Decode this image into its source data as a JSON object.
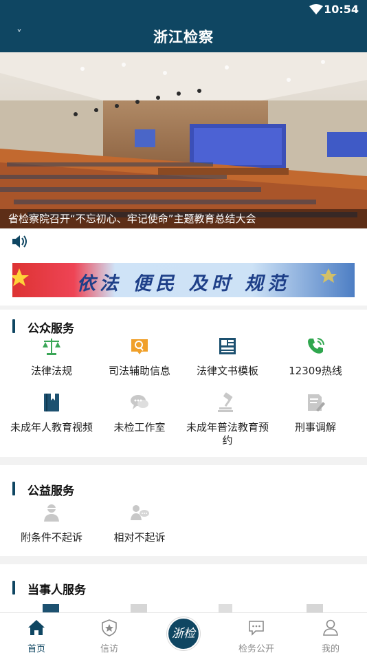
{
  "status": {
    "time": "10:54"
  },
  "app": {
    "title": "浙江检察",
    "back_glyph": "˅"
  },
  "banner": {
    "caption": "省检察院召开“不忘初心、牢记使命”主题教育总结大会"
  },
  "slogan": {
    "text": "依法 便民 及时 规范"
  },
  "public_services": {
    "title": "公众服务",
    "items": [
      {
        "label": "法律法规",
        "icon": "scales-icon",
        "color": "#3aa657"
      },
      {
        "label": "司法辅助信息",
        "icon": "search-doc-icon",
        "color": "#f0a02a"
      },
      {
        "label": "法律文书模板",
        "icon": "template-icon",
        "color": "#1d5170"
      },
      {
        "label": "12309热线",
        "icon": "phone-icon",
        "color": "#2fa64e"
      },
      {
        "label": "未成年人教育视频",
        "icon": "book-icon",
        "color": "#1d5170"
      },
      {
        "label": "未检工作室",
        "icon": "chat-icon",
        "color": "#c8c8c8"
      },
      {
        "label": "未成年普法教育预约",
        "icon": "gavel-icon",
        "color": "#c8c8c8"
      },
      {
        "label": "刑事调解",
        "icon": "edit-doc-icon",
        "color": "#c8c8c8"
      }
    ]
  },
  "welfare_services": {
    "title": "公益服务",
    "items": [
      {
        "label": "附条件不起诉",
        "icon": "person-icon",
        "color": "#c8c8c8"
      },
      {
        "label": "相对不起诉",
        "icon": "person-chat-icon",
        "color": "#c8c8c8"
      }
    ]
  },
  "party_services": {
    "title": "当事人服务"
  },
  "tabs": [
    {
      "label": "首页",
      "icon": "home-icon",
      "active": true
    },
    {
      "label": "信访",
      "icon": "badge-star-icon",
      "active": false
    },
    {
      "label": "",
      "icon": "zhejian-logo",
      "active": false
    },
    {
      "label": "检务公开",
      "icon": "message-icon",
      "active": false
    },
    {
      "label": "我的",
      "icon": "user-icon",
      "active": false
    }
  ],
  "logo_text": "浙检",
  "colors": {
    "primary": "#0f4662",
    "accent_green": "#3aa657",
    "accent_orange": "#f0a02a"
  }
}
